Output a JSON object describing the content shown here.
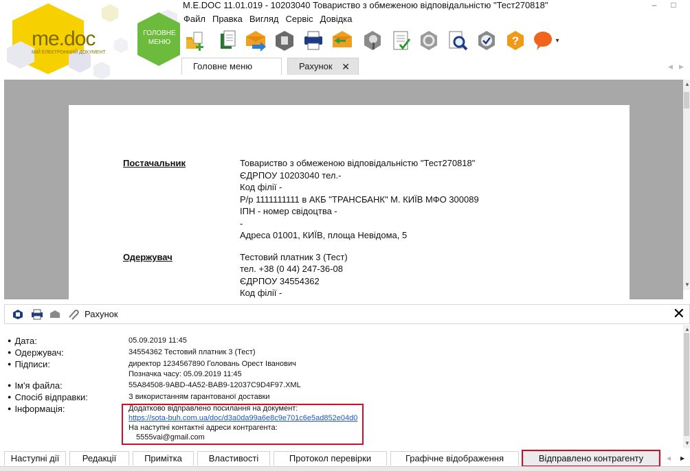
{
  "app": {
    "title": "M.E.DOC 11.01.019  - 10203040 Товариство з обмеженою відповідальністю \"Тест270818\"",
    "logo_text": "me.doc",
    "logo_subtitle": "МІЙ ЕЛЕКТРОННИЙ ДОКУМЕНТ",
    "home_button_label": "ГОЛОВНЕ МЕНЮ",
    "window_controls": {
      "minimize": "–",
      "maximize": "□"
    }
  },
  "menu": {
    "items": [
      "Файл",
      "Правка",
      "Вигляд",
      "Сервіс",
      "Довідка"
    ]
  },
  "toolbar": {
    "buttons": [
      "create-document-icon",
      "copy-document-icon",
      "send-document-icon",
      "archive-document-icon",
      "print-icon",
      "receive-document-icon",
      "signature-icon",
      "checklist-icon",
      "refresh-icon",
      "search-document-icon",
      "verify-icon",
      "help-icon",
      "chat-icon"
    ],
    "more_arrow": "▾"
  },
  "tabs": {
    "main_label": "Головне меню",
    "invoice_label": "Рахунок",
    "close_glyph": "✕"
  },
  "document": {
    "supplier_label": "Постачальник",
    "supplier_lines": [
      "Товариство з обмеженою відповідальністю \"Тест270818\"",
      "ЄДРПОУ  10203040  тел.-",
      "Код філії -",
      "Р/р 1111111111  в АКБ \"ТРАНСБАНК\" М. КИЇВ МФО 300089",
      "ІПН  -      номер свідоцтва -",
      "-",
      "Адреса 01001, КИЇВ, площа Невідома, 5"
    ],
    "recipient_label": "Одержувач",
    "recipient_lines": [
      "Тестовий  платник 3 (Тест)",
      "тел. +38 (0 44) 247-36-08",
      "ЄДРПОУ  34554362",
      "Код філії -"
    ]
  },
  "info_panel": {
    "title": "Рахунок",
    "close_glyph": "✕",
    "rows": {
      "date_label": "Дата:",
      "date_value": "05.09.2019 11:45",
      "recipient_label": "Одержувач:",
      "recipient_value": "34554362 Тестовий платник 3 (Тест)",
      "signatures_label": "Підписи:",
      "signatures_value": "директор 1234567890 Головань Орест Іванович",
      "timestamp_value": "Позначка часу: 05.09.2019 11:45",
      "filename_label": "Ім'я файла:",
      "filename_value": "55A84508-9ABD-4A52-BAB9-12037C9D4F97.XML",
      "method_label": "Спосіб відправки:",
      "method_value": "З використанням гарантованої доставки",
      "info_label": "Інформація:",
      "info_line1": "Додатково відправлено посилання на документ:",
      "info_link": "https://sota-buh.com.ua/doc/d3a0da99a6e8c9e701c6e5ad852e04d0",
      "info_line2": "На наступні контактні адреси контрагента:",
      "info_email": "5555vai@gmail.com"
    }
  },
  "bottom_tabs": [
    "Наступні дії",
    "Редакції",
    "Примітка",
    "Властивості",
    "Протокол перевірки",
    "Графічне відображення",
    "Відправлено контрагенту"
  ],
  "colors": {
    "highlight_red": "#c8102e",
    "logo_yellow": "#f7d000",
    "home_green": "#6dbb3c",
    "link_blue": "#1a56c4"
  }
}
